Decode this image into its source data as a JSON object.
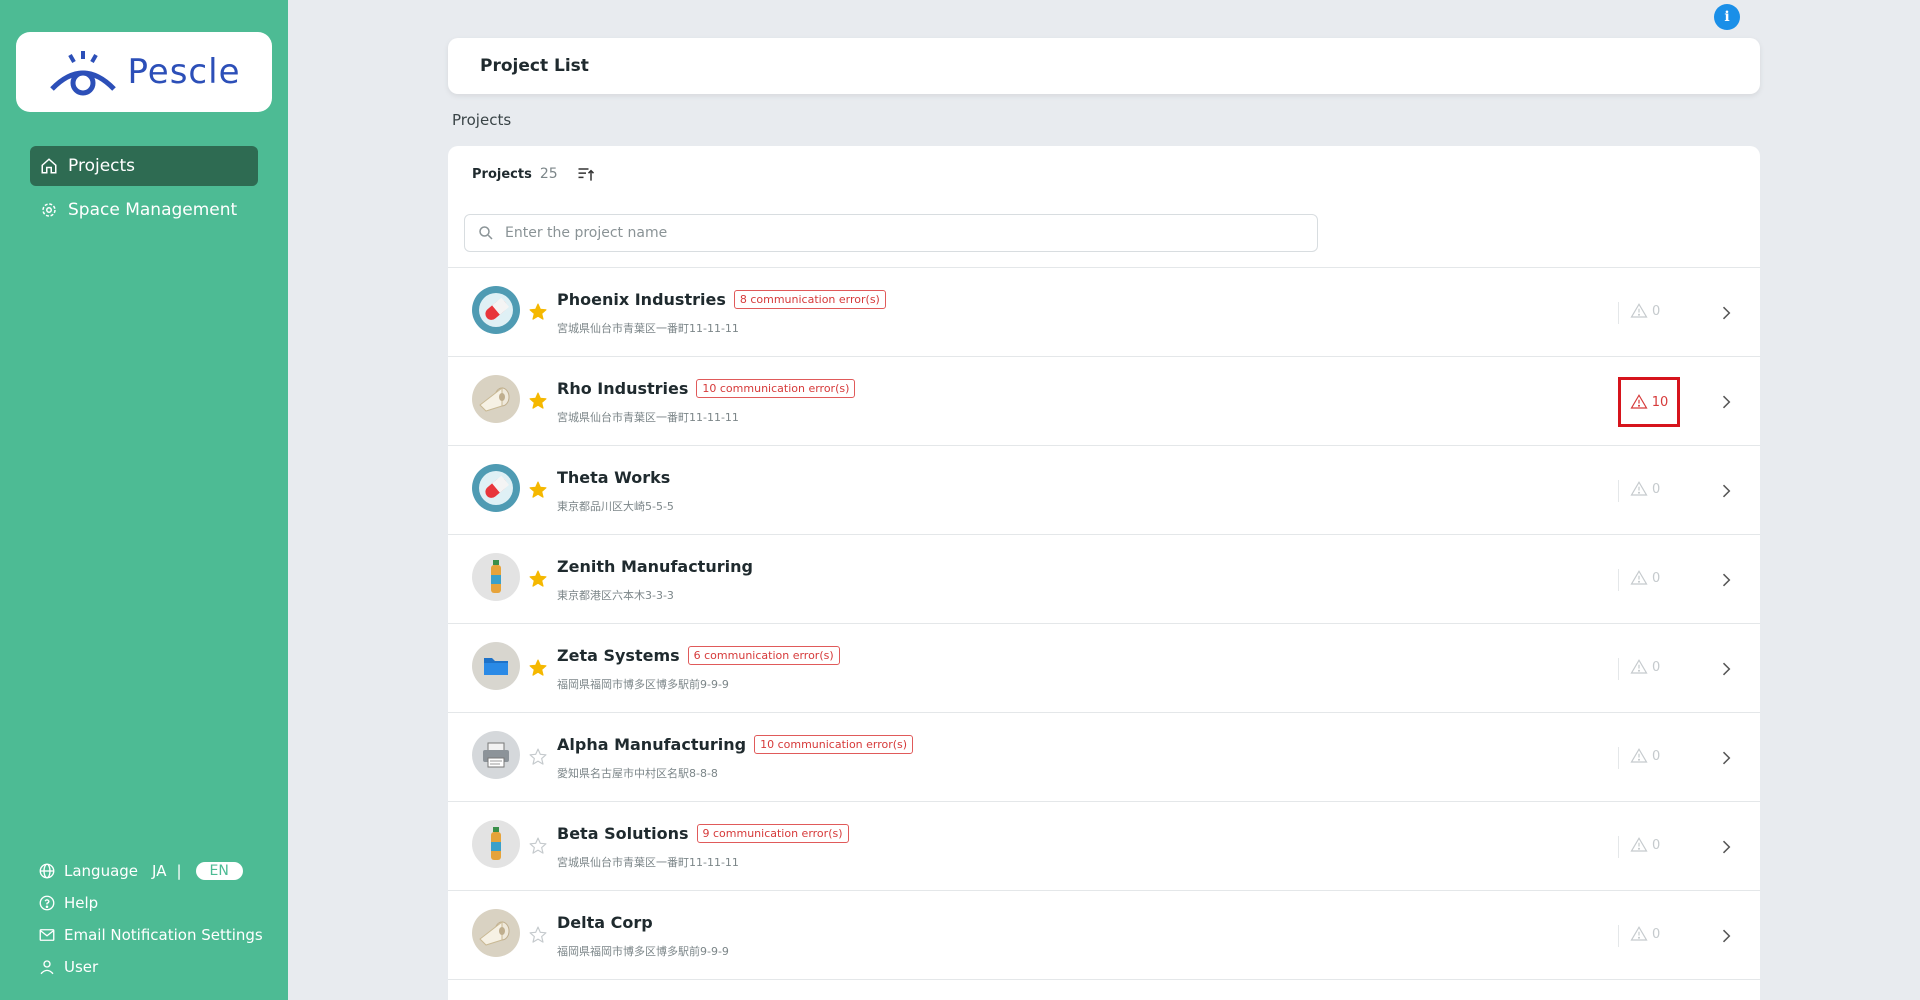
{
  "brand": {
    "name": "Pescle",
    "accent": "#4dbb94",
    "logo_color": "#2c4fb8"
  },
  "sidebar": {
    "nav": [
      {
        "label": "Projects",
        "icon": "home-icon",
        "active": true
      },
      {
        "label": "Space Management",
        "icon": "gear-icon",
        "active": false
      }
    ],
    "bottom": {
      "language_label": "Language",
      "lang_ja": "JA",
      "lang_sep": "|",
      "lang_en": "EN",
      "help": "Help",
      "email": "Email Notification Settings",
      "user": "User"
    }
  },
  "header": {
    "title": "Project List",
    "info": "i"
  },
  "section_label": "Projects",
  "list": {
    "title": "Projects",
    "count": "25",
    "search_placeholder": "Enter the project name"
  },
  "projects": [
    {
      "name": "Phoenix Industries",
      "badge": "8 communication error(s)",
      "address": "宮城県仙台市青葉区一番町11-11-11",
      "starred": true,
      "alerts": "0",
      "alert_active": false,
      "icon": "pill-icon"
    },
    {
      "name": "Rho Industries",
      "badge": "10 communication error(s)",
      "address": "宮城県仙台市青葉区一番町11-11-11",
      "starred": true,
      "alerts": "10",
      "alert_active": true,
      "icon": "paper-roll-icon"
    },
    {
      "name": "Theta Works",
      "badge": "",
      "address": "東京都品川区大崎5-5-5",
      "starred": true,
      "alerts": "0",
      "alert_active": false,
      "icon": "pill-icon"
    },
    {
      "name": "Zenith Manufacturing",
      "badge": "",
      "address": "東京都港区六本木3-3-3",
      "starred": true,
      "alerts": "0",
      "alert_active": false,
      "icon": "bottle-icon"
    },
    {
      "name": "Zeta Systems",
      "badge": "6 communication error(s)",
      "address": "福岡県福岡市博多区博多駅前9-9-9",
      "starred": true,
      "alerts": "0",
      "alert_active": false,
      "icon": "folder-icon"
    },
    {
      "name": "Alpha Manufacturing",
      "badge": "10 communication error(s)",
      "address": "愛知県名古屋市中村区名駅8-8-8",
      "starred": false,
      "alerts": "0",
      "alert_active": false,
      "icon": "printer-icon"
    },
    {
      "name": "Beta Solutions",
      "badge": "9 communication error(s)",
      "address": "宮城県仙台市青葉区一番町11-11-11",
      "starred": false,
      "alerts": "0",
      "alert_active": false,
      "icon": "bottle-icon"
    },
    {
      "name": "Delta Corp",
      "badge": "",
      "address": "福岡県福岡市博多区博多駅前9-9-9",
      "starred": false,
      "alerts": "0",
      "alert_active": false,
      "icon": "paper-roll-icon"
    }
  ]
}
